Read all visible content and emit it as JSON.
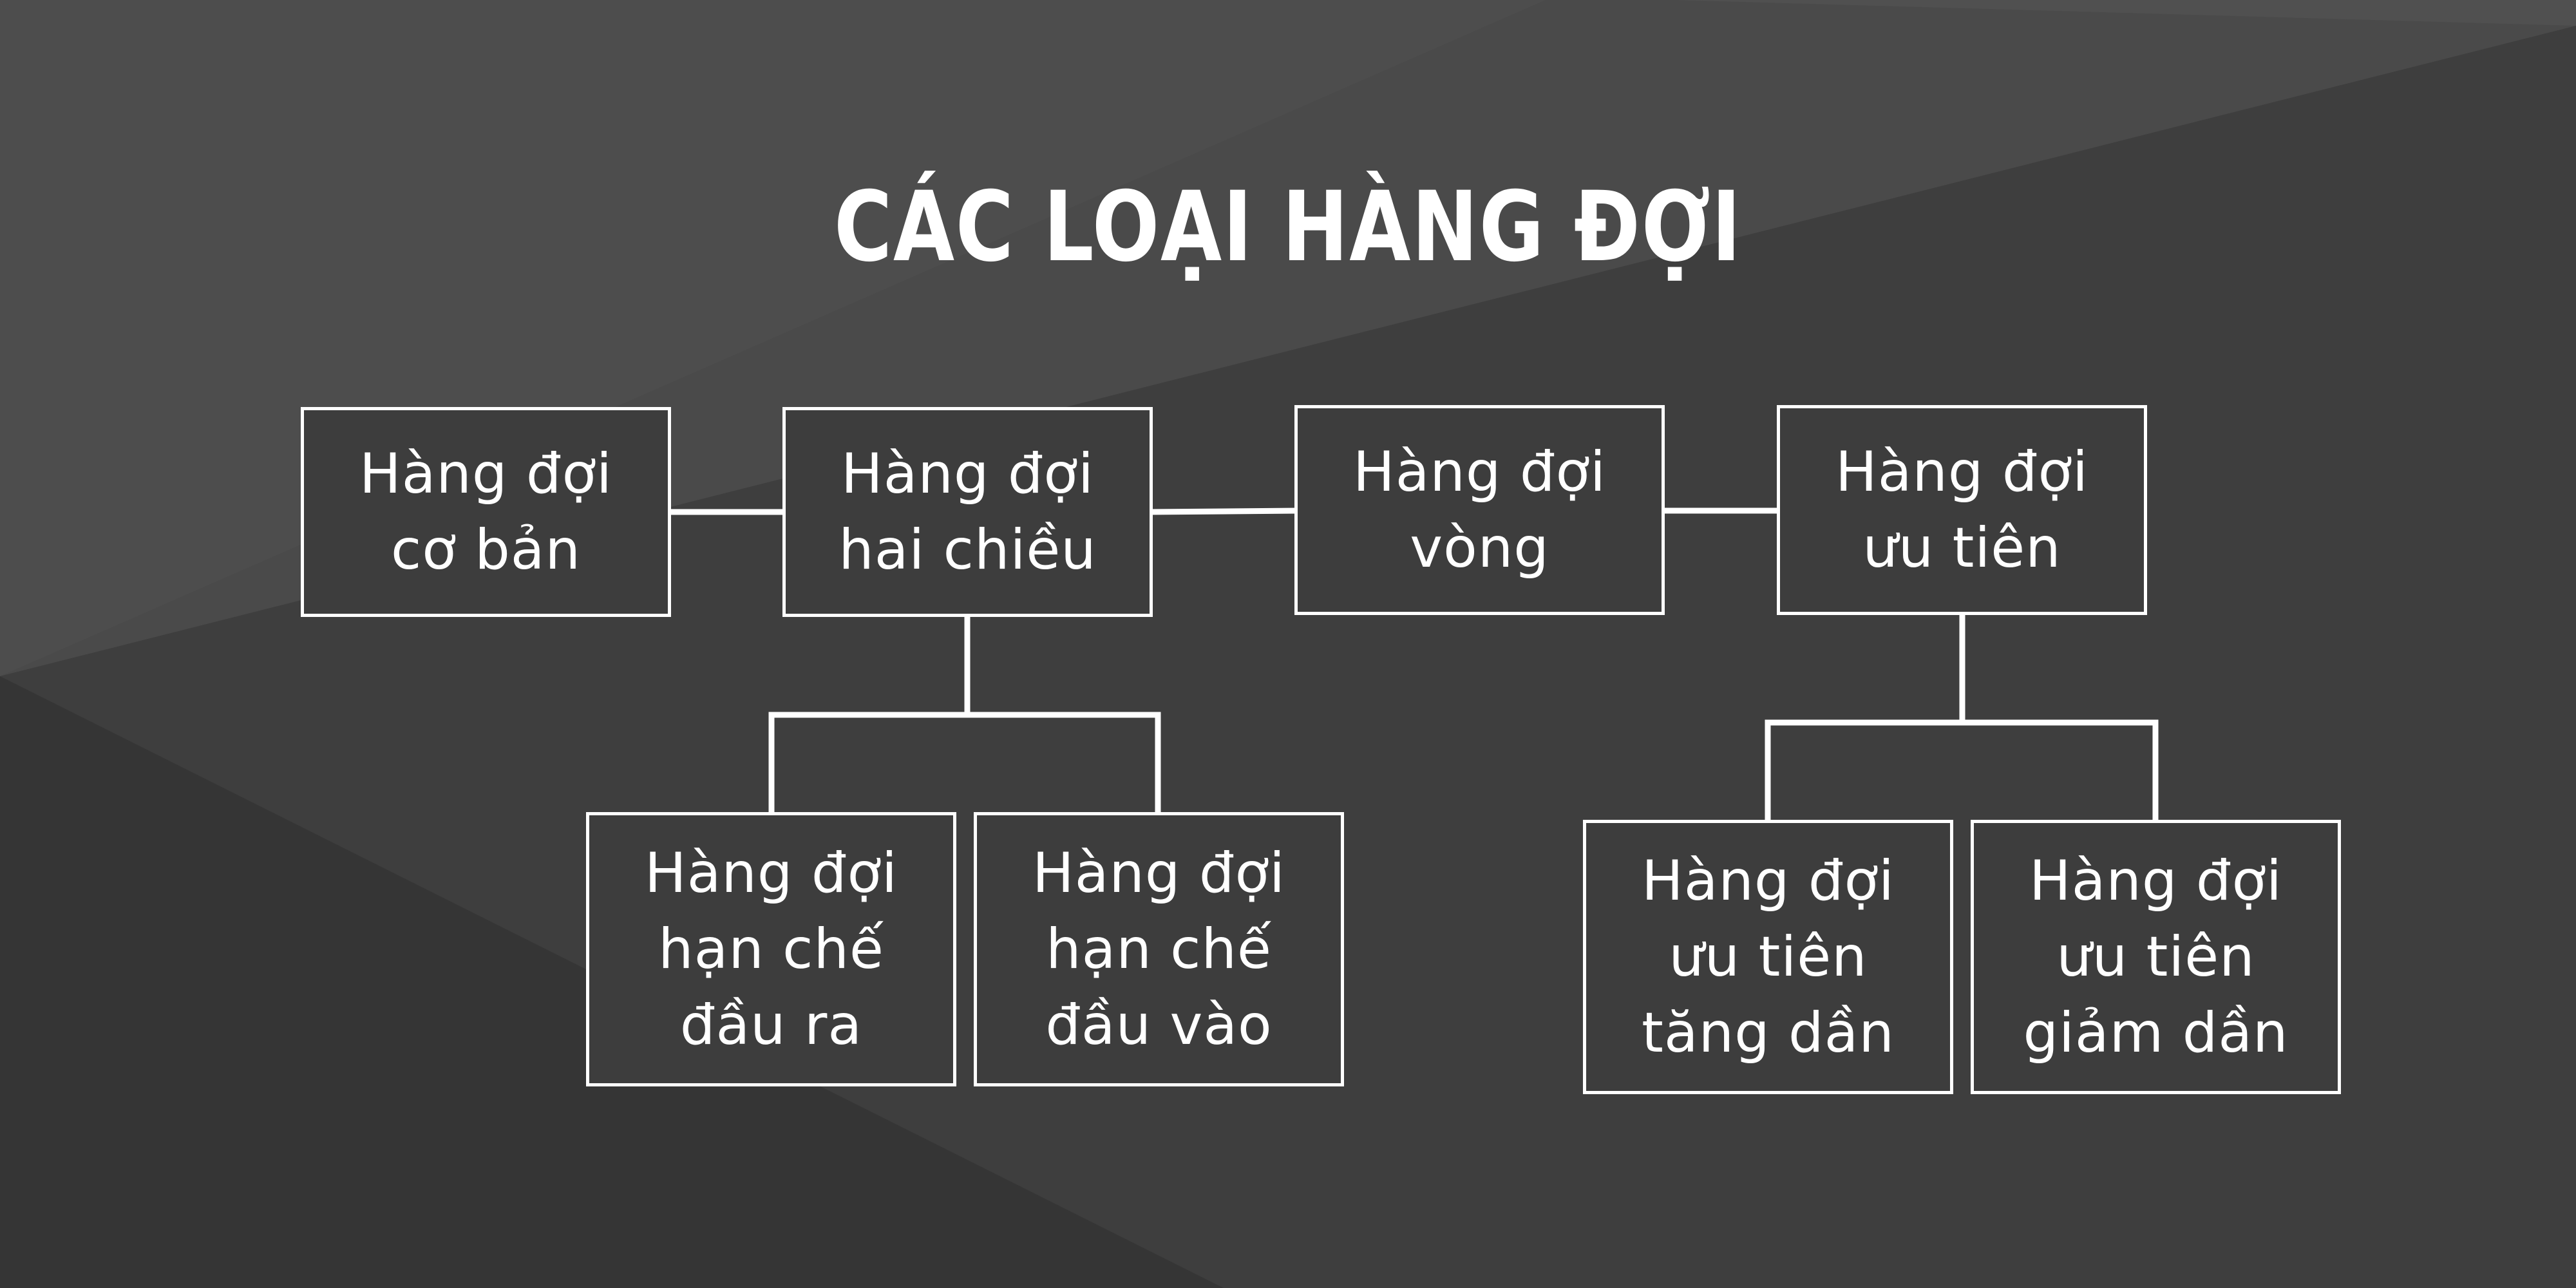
{
  "diagram": {
    "title": "CÁC LOẠI HÀNG ĐỢI",
    "nodes": {
      "basic": "Hàng đợi\ncơ bản",
      "deque": "Hàng đợi\nhai chiều",
      "circular": "Hàng đợi\nvòng",
      "priority": "Hàng đợi\nưu tiên",
      "output_restricted": "Hàng đợi\nhạn chế\nđầu ra",
      "input_restricted": "Hàng đợi\nhạn chế\nđầu vào",
      "priority_ascending": "Hàng đợi\nưu tiên\ntăng dần",
      "priority_descending": "Hàng đợi\nưu tiên\ngiảm dần"
    },
    "colors": {
      "background": "#3f3f3f",
      "box_fill": "#3d3d3d",
      "stroke": "#ffffff",
      "text": "#ffffff"
    }
  }
}
